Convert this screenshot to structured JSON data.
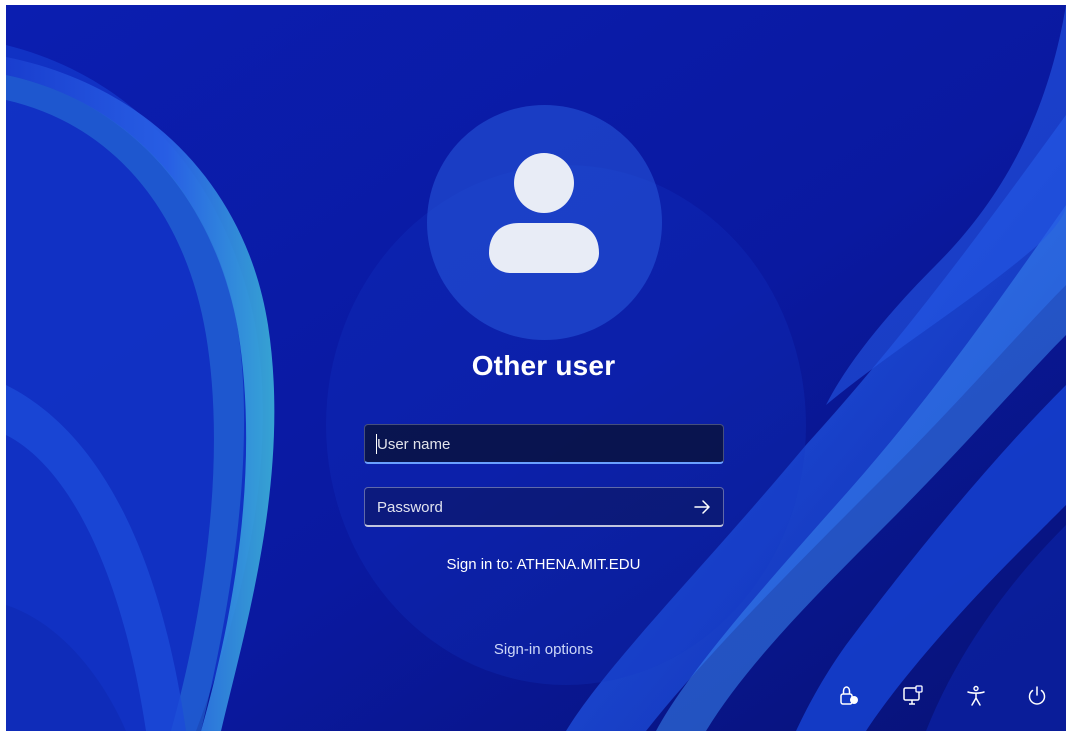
{
  "user": {
    "display_name": "Other user",
    "avatar_icon": "person-icon"
  },
  "username_field": {
    "placeholder": "User name",
    "value": ""
  },
  "password_field": {
    "placeholder": "Password",
    "value": "",
    "submit_icon": "arrow-right-icon"
  },
  "sign_in_domain": "Sign in to: ATHENA.MIT.EDU",
  "sign_in_options_label": "Sign-in options",
  "tray": [
    {
      "name": "network-icon"
    },
    {
      "name": "remote-desktop-icon"
    },
    {
      "name": "accessibility-icon"
    },
    {
      "name": "power-icon"
    }
  ],
  "colors": {
    "background": "#0a1aa8",
    "accent": "#6aa0ff"
  }
}
